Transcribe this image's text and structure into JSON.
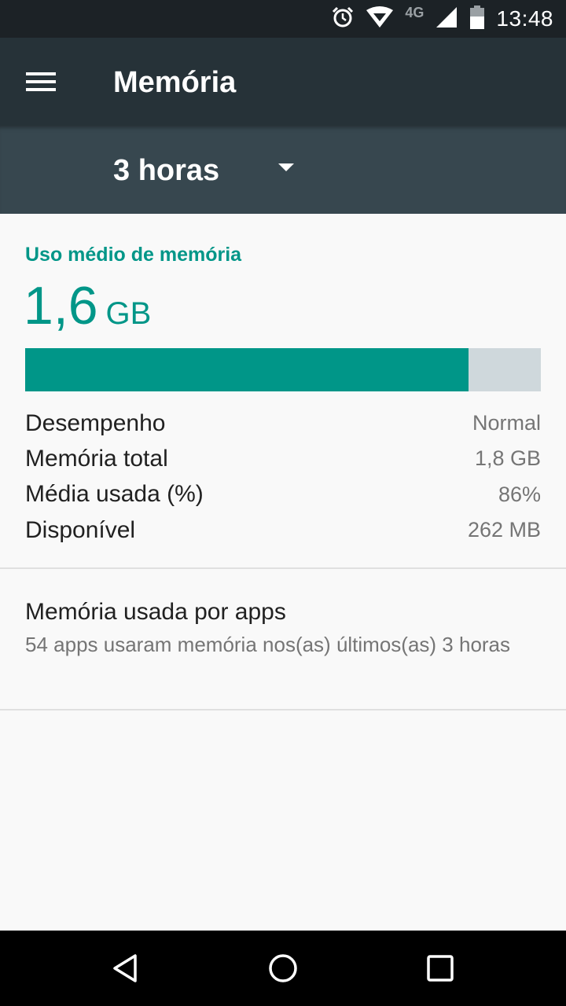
{
  "status_bar": {
    "time": "13:48",
    "network": "4G",
    "icons": [
      "alarm-icon",
      "wifi-icon",
      "signal-icon",
      "battery-icon"
    ]
  },
  "app_bar": {
    "title": "Memória",
    "menu_icon": "hamburger-menu-icon"
  },
  "period_selector": {
    "selected": "3 horas",
    "icon": "dropdown-arrow-icon"
  },
  "summary": {
    "heading": "Uso médio de memória",
    "average_value": "1,6",
    "average_unit": "GB",
    "usage_fraction": 0.86,
    "rows": [
      {
        "label": "Desempenho",
        "value": "Normal"
      },
      {
        "label": "Memória total",
        "value": "1,8 GB"
      },
      {
        "label": "Média usada (%)",
        "value": "86%"
      },
      {
        "label": "Disponível",
        "value": "262 MB"
      }
    ]
  },
  "apps_section": {
    "title": "Memória usada por apps",
    "subtitle": "54 apps usaram memória nos(as) últimos(as) 3 horas"
  },
  "colors": {
    "accent": "#009688",
    "app_bar": "#263238",
    "selector_bar": "#37474f",
    "bar_track": "#cfd8dc"
  },
  "nav_bar": {
    "icons": [
      "back-icon",
      "home-icon",
      "recents-icon"
    ]
  }
}
